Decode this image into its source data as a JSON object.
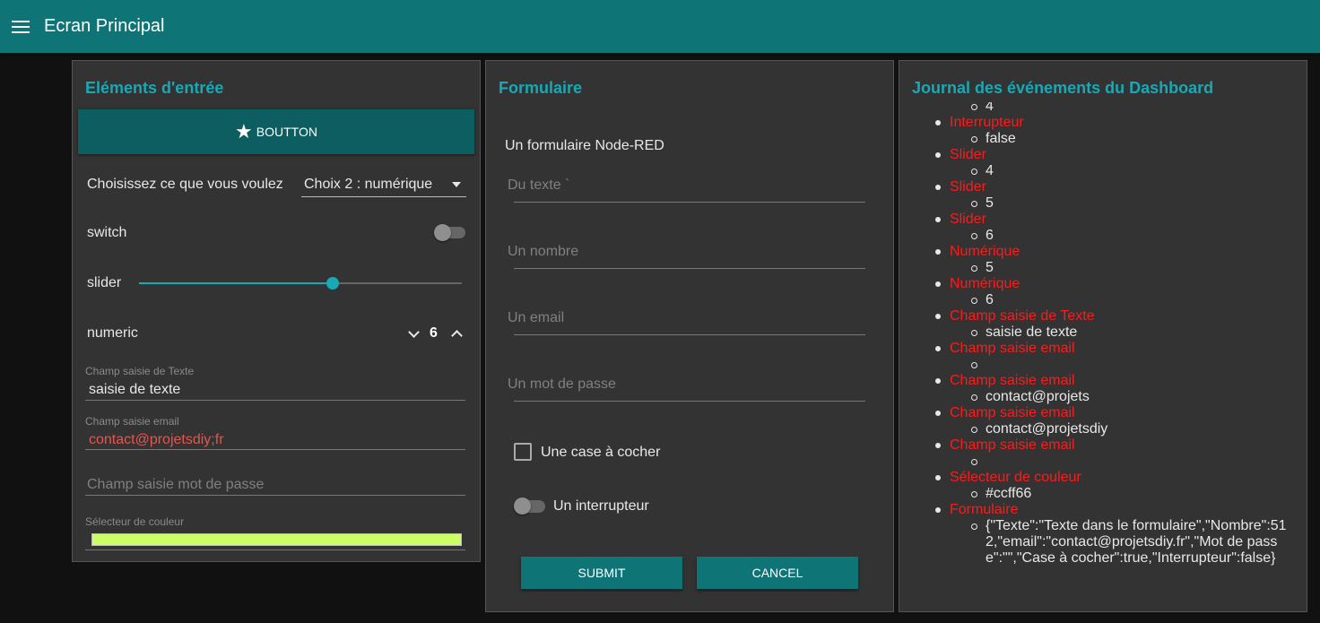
{
  "app": {
    "title": "Ecran Principal",
    "menu_icon": "menu-icon"
  },
  "inputs_card": {
    "title": "Eléments d'entrée",
    "button": {
      "label": "BOUTTON",
      "icon": "star-icon"
    },
    "select": {
      "label": "Choisissez ce que vous voulez",
      "value": "Choix 2 : numérique"
    },
    "switch": {
      "label": "switch",
      "on": false
    },
    "slider": {
      "label": "slider",
      "fraction": 0.6
    },
    "numeric": {
      "label": "numeric",
      "value": "6"
    },
    "text_field": {
      "label": "Champ saisie de Texte",
      "value": "saisie de texte"
    },
    "email_field": {
      "label": "Champ saisie email",
      "value": "contact@projetsdiy;fr"
    },
    "password_field": {
      "placeholder": "Champ saisie mot de passe"
    },
    "color_picker": {
      "label": "Sélecteur de couleur",
      "value": "#ccff66"
    }
  },
  "form_card": {
    "title": "Formulaire",
    "intro": "Un formulaire Node-RED",
    "fields": {
      "text": "Du texte `",
      "number": "Un nombre",
      "email": "Un email",
      "password": "Un mot de passe"
    },
    "checkbox_label": "Une case à cocher",
    "switch_label": "Un interrupteur",
    "submit_label": "SUBMIT",
    "cancel_label": "CANCEL"
  },
  "log_card": {
    "title": "Journal des événements du Dashboard",
    "first_value": "4",
    "events": [
      {
        "name": "Interrupteur",
        "value": "false"
      },
      {
        "name": "Slider",
        "value": "4"
      },
      {
        "name": "Slider",
        "value": "5"
      },
      {
        "name": "Slider",
        "value": "6"
      },
      {
        "name": "Numérique",
        "value": "5"
      },
      {
        "name": "Numérique",
        "value": "6"
      },
      {
        "name": "Champ saisie de Texte",
        "value": "saisie de texte"
      },
      {
        "name": "Champ saisie email",
        "value": ""
      },
      {
        "name": "Champ saisie email",
        "value": "contact@projets"
      },
      {
        "name": "Champ saisie email",
        "value": "contact@projetsdiy"
      },
      {
        "name": "Champ saisie email",
        "value": ""
      },
      {
        "name": "Sélecteur de couleur",
        "value": "#ccff66"
      },
      {
        "name": "Formulaire",
        "value": "{\"Texte\":\"Texte dans le formulaire\",\"Nombre\":512,\"email\":\"contact@projetsdiy.fr\",\"Mot de passe\":\"\",\"Case à cocher\":true,\"Interrupteur\":false}"
      }
    ]
  },
  "colors": {
    "accent": "#17a9b5",
    "topbar": "#0e7476",
    "button_dark": "#0d5e60",
    "event_name": "#ff1a1a",
    "email_value": "#e5564e",
    "card_bg": "#333333",
    "page_bg": "#111111"
  }
}
